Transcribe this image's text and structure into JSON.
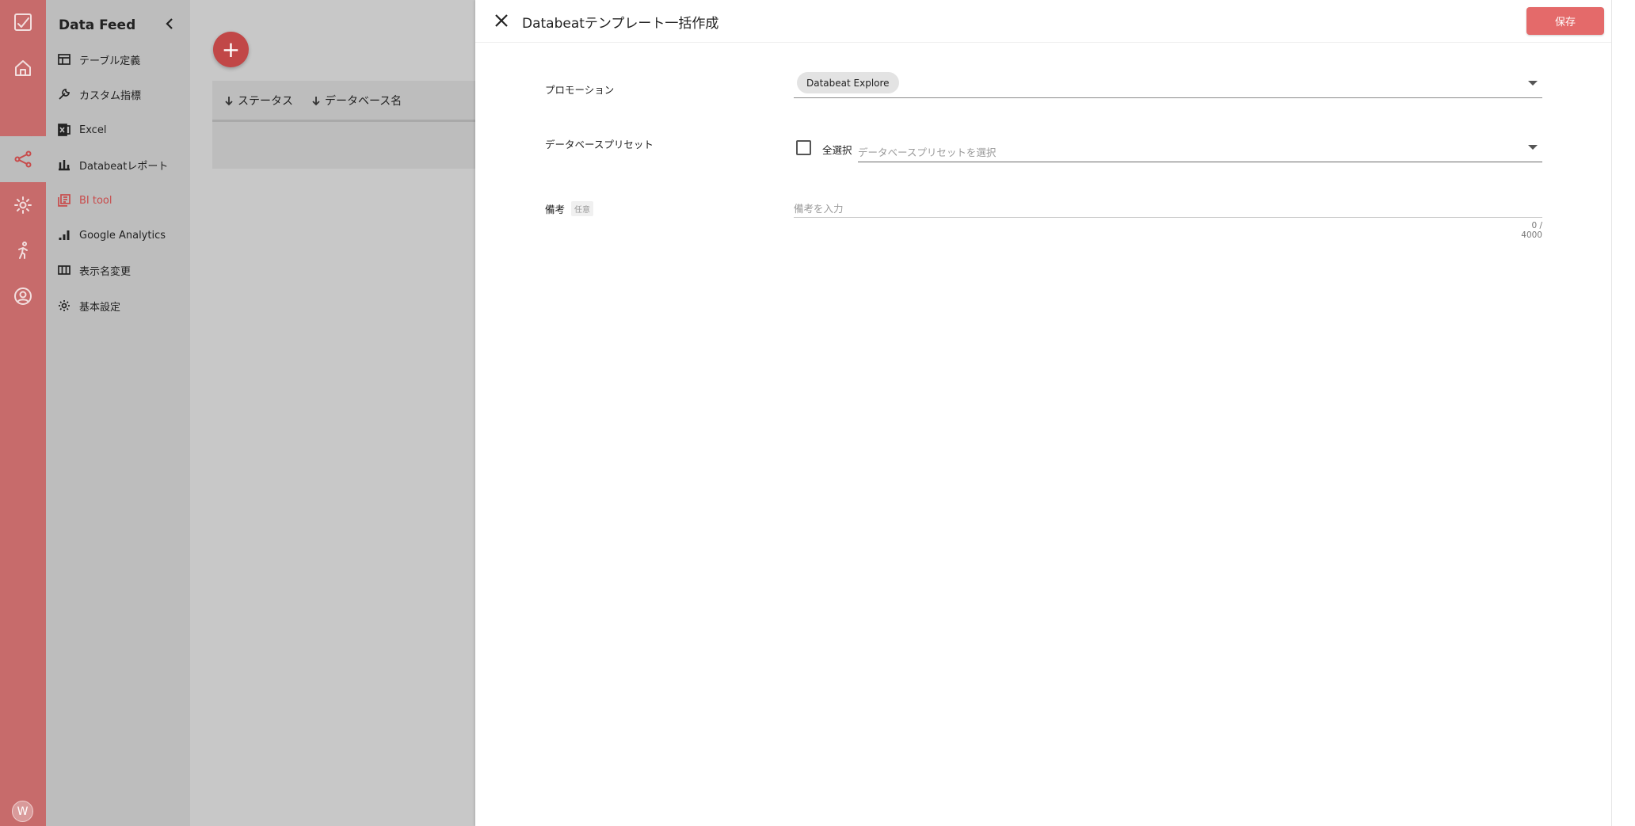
{
  "sidebar": {
    "title": "Data Feed",
    "items": [
      {
        "label": "テーブル定義",
        "icon": "table-icon"
      },
      {
        "label": "カスタム指標",
        "icon": "wrench-icon"
      },
      {
        "label": "Excel",
        "icon": "excel-icon"
      },
      {
        "label": "Databeatレポート",
        "icon": "bar-chart-icon"
      },
      {
        "label": "BI tool",
        "icon": "bi-tool-icon",
        "active": true
      },
      {
        "label": "Google Analytics",
        "icon": "analytics-icon"
      },
      {
        "label": "表示名変更",
        "icon": "columns-icon"
      },
      {
        "label": "基本設定",
        "icon": "gear-icon"
      }
    ]
  },
  "rail": {
    "items": [
      "logo-icon",
      "home-icon",
      "download-icon",
      "share-icon",
      "settings-icon",
      "runner-icon",
      "account-icon"
    ],
    "avatar": "W"
  },
  "background_table": {
    "columns": [
      "ステータス",
      "データベース名"
    ]
  },
  "dialog": {
    "title": "Databeatテンプレート一括作成",
    "save_label": "保存",
    "promotion": {
      "label": "プロモーション",
      "selected_chip": "Databeat Explore"
    },
    "database_preset": {
      "label": "データベースプリセット",
      "select_all_label": "全選択",
      "placeholder": "データベースプリセットを選択"
    },
    "remarks": {
      "label": "備考",
      "optional_badge": "任意",
      "placeholder": "備考を入力",
      "char_count": "0 / 4000"
    }
  },
  "colors": {
    "accent": "#e46a6a",
    "rail": "#c76b6b",
    "active_nav": "#c84b4b"
  }
}
